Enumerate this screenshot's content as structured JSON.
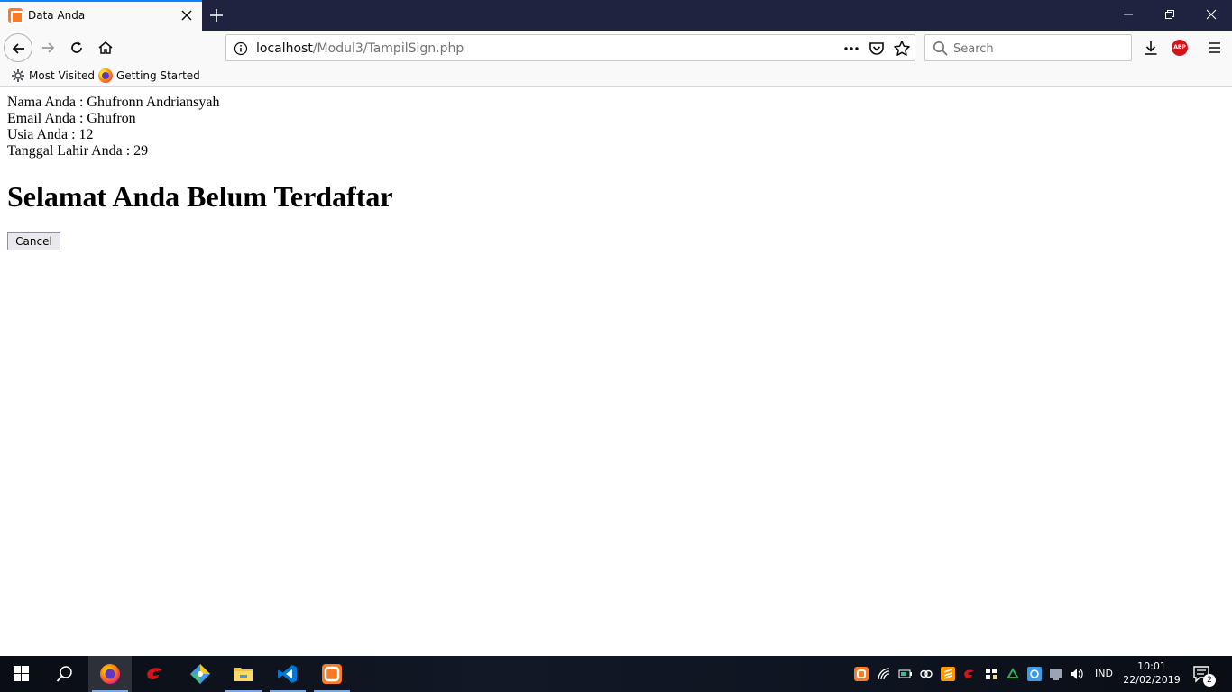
{
  "browser": {
    "tab": {
      "title": "Data Anda"
    },
    "url": {
      "host": "localhost",
      "path": "/Modul3/TampilSign.php"
    },
    "search": {
      "placeholder": "Search"
    },
    "bookmarks": [
      {
        "label": "Most Visited",
        "icon": "gear-icon"
      },
      {
        "label": "Getting Started",
        "icon": "firefox-icon"
      }
    ],
    "abp_label": "ABP"
  },
  "page": {
    "info_lines": [
      "Nama Anda : Ghufronn Andriansyah",
      "Email Anda : Ghufron",
      "Usia Anda : 12",
      "Tanggal Lahir Anda : 29"
    ],
    "heading": "Selamat Anda Belum Terdaftar",
    "cancel_label": "Cancel"
  },
  "taskbar": {
    "language": "IND",
    "time": "10:01",
    "date": "22/02/2019",
    "notification_count": "2"
  },
  "colors": {
    "titlebar": "#202340",
    "tab_accent": "#0a84ff",
    "xampp_orange": "#fb7a24",
    "vscode_blue": "#0078d4"
  }
}
